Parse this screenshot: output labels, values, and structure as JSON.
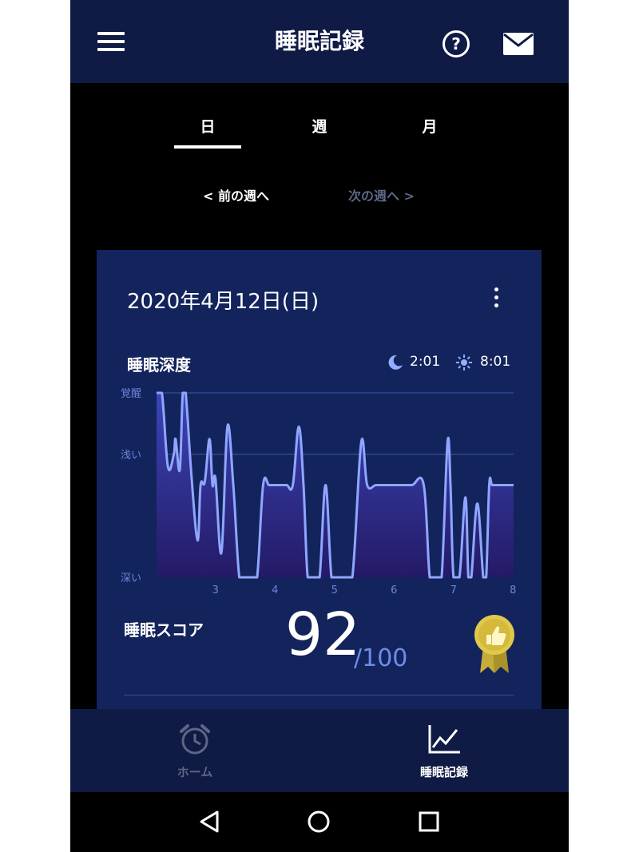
{
  "header": {
    "title": "睡眠記録",
    "menu_icon": "menu-icon",
    "help_icon": "help-icon",
    "help_glyph": "?",
    "mail_icon": "mail-icon"
  },
  "tabs": [
    {
      "label": "日",
      "active": true
    },
    {
      "label": "週",
      "active": false
    },
    {
      "label": "月",
      "active": false
    }
  ],
  "week_nav": {
    "prev": "< 前の週へ",
    "next": "次の週へ >"
  },
  "card": {
    "date": "2020年4月12日(日)",
    "depth_title": "睡眠深度",
    "sleep_start": "2:01",
    "wake_time": "8:01",
    "score_label": "睡眠スコア",
    "score": "92",
    "score_max": "/100",
    "badge_icon": "thumbs-up-medal-icon"
  },
  "chart_data": {
    "type": "line",
    "title": "睡眠深度",
    "y_categories": [
      "深い",
      "浅い",
      "覚醒"
    ],
    "x_ticks": [
      "3",
      "4",
      "5",
      "6",
      "7",
      "8"
    ],
    "xlim": [
      2.01,
      8.01
    ],
    "ylim": [
      0,
      3
    ],
    "x": [
      2.01,
      2.1,
      2.2,
      2.3,
      2.33,
      2.4,
      2.45,
      2.5,
      2.6,
      2.7,
      2.75,
      2.82,
      2.9,
      2.95,
      3.0,
      3.1,
      3.2,
      3.3,
      3.4,
      3.5,
      3.6,
      3.7,
      3.8,
      3.9,
      4.0,
      4.1,
      4.2,
      4.3,
      4.4,
      4.48,
      4.55,
      4.65,
      4.75,
      4.85,
      4.95,
      5.05,
      5.15,
      5.3,
      5.45,
      5.55,
      5.7,
      5.9,
      6.1,
      6.3,
      6.5,
      6.6,
      6.7,
      6.8,
      6.9,
      6.95,
      7.0,
      7.1,
      7.2,
      7.25,
      7.3,
      7.4,
      7.5,
      7.55,
      7.6,
      7.65,
      7.75,
      7.85,
      7.95,
      8.01
    ],
    "y": [
      3.0,
      3.0,
      1.8,
      2.0,
      2.25,
      1.75,
      3.0,
      3.0,
      1.6,
      0.6,
      1.5,
      1.55,
      2.25,
      1.5,
      1.6,
      0.4,
      2.45,
      1.5,
      0.0,
      0.0,
      0.0,
      0.0,
      1.5,
      1.5,
      1.5,
      1.5,
      1.5,
      1.5,
      2.45,
      1.5,
      0.0,
      0.0,
      0.0,
      1.5,
      0.0,
      0.0,
      0.0,
      0.0,
      2.2,
      1.5,
      1.5,
      1.5,
      1.5,
      1.5,
      1.5,
      0.0,
      0.0,
      0.0,
      2.2,
      1.5,
      0.0,
      0.0,
      1.3,
      0.0,
      0.0,
      1.2,
      0.0,
      0.0,
      1.5,
      1.5,
      1.5,
      1.5,
      1.5,
      1.5
    ],
    "grid": true,
    "colors": {
      "line": "#8fa6ff",
      "fill_top": "#3b45b8",
      "fill_bottom": "#241a66",
      "grid": "#3d55a8",
      "label": "#6e86d8"
    }
  },
  "bottom_nav": [
    {
      "label": "ホーム",
      "icon": "alarm-clock-icon",
      "active": false
    },
    {
      "label": "睡眠記録",
      "icon": "line-chart-icon",
      "active": true
    }
  ],
  "system_nav": {
    "back": "back-triangle-icon",
    "home": "home-circle-icon",
    "recents": "recents-square-icon"
  },
  "colors": {
    "appbar": "#0f1a45",
    "card": "#13235c",
    "background": "#000000",
    "accent": "#6f8ce8",
    "inactive": "#5c6785",
    "badge": "#e0c84a"
  }
}
